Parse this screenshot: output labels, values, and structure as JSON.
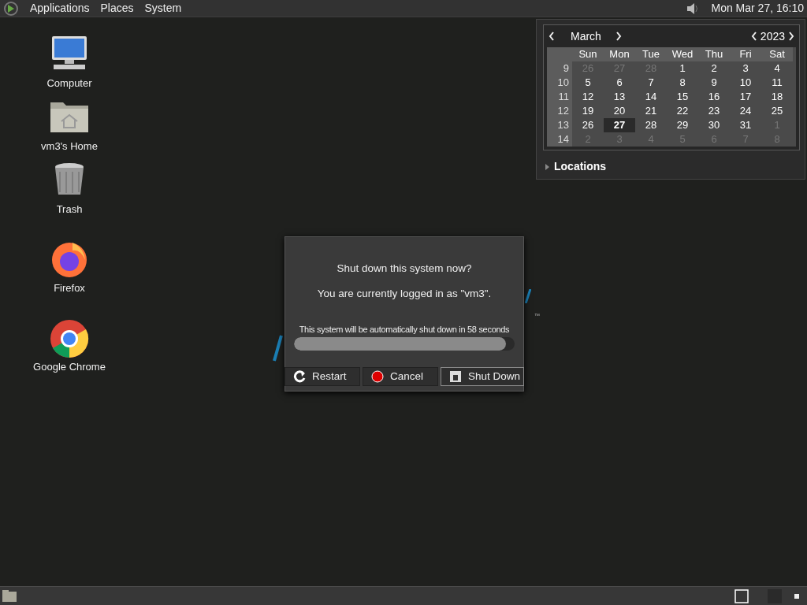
{
  "top_panel": {
    "menus": [
      "Applications",
      "Places",
      "System"
    ],
    "clock": "Mon Mar 27, 16:10"
  },
  "desktop_icons": [
    {
      "kind": "computer",
      "label": "Computer"
    },
    {
      "kind": "home",
      "label": "vm3's Home"
    },
    {
      "kind": "trash",
      "label": "Trash"
    },
    {
      "kind": "firefox",
      "label": "Firefox"
    },
    {
      "kind": "chrome",
      "label": "Google Chrome"
    }
  ],
  "calendar": {
    "month": "March",
    "year": "2023",
    "weekdays": [
      "Sun",
      "Mon",
      "Tue",
      "Wed",
      "Thu",
      "Fri",
      "Sat"
    ],
    "weeks": [
      {
        "number": "9",
        "days": [
          {
            "d": "26",
            "other": true,
            "selected": false
          },
          {
            "d": "27",
            "other": true,
            "selected": false
          },
          {
            "d": "28",
            "other": true,
            "selected": false
          },
          {
            "d": "1",
            "other": false,
            "selected": false
          },
          {
            "d": "2",
            "other": false,
            "selected": false
          },
          {
            "d": "3",
            "other": false,
            "selected": false
          },
          {
            "d": "4",
            "other": false,
            "selected": false
          }
        ]
      },
      {
        "number": "10",
        "days": [
          {
            "d": "5",
            "other": false,
            "selected": false
          },
          {
            "d": "6",
            "other": false,
            "selected": false
          },
          {
            "d": "7",
            "other": false,
            "selected": false
          },
          {
            "d": "8",
            "other": false,
            "selected": false
          },
          {
            "d": "9",
            "other": false,
            "selected": false
          },
          {
            "d": "10",
            "other": false,
            "selected": false
          },
          {
            "d": "11",
            "other": false,
            "selected": false
          }
        ]
      },
      {
        "number": "11",
        "days": [
          {
            "d": "12",
            "other": false,
            "selected": false
          },
          {
            "d": "13",
            "other": false,
            "selected": false
          },
          {
            "d": "14",
            "other": false,
            "selected": false
          },
          {
            "d": "15",
            "other": false,
            "selected": false
          },
          {
            "d": "16",
            "other": false,
            "selected": false
          },
          {
            "d": "17",
            "other": false,
            "selected": false
          },
          {
            "d": "18",
            "other": false,
            "selected": false
          }
        ]
      },
      {
        "number": "12",
        "days": [
          {
            "d": "19",
            "other": false,
            "selected": false
          },
          {
            "d": "20",
            "other": false,
            "selected": false
          },
          {
            "d": "21",
            "other": false,
            "selected": false
          },
          {
            "d": "22",
            "other": false,
            "selected": false
          },
          {
            "d": "23",
            "other": false,
            "selected": false
          },
          {
            "d": "24",
            "other": false,
            "selected": false
          },
          {
            "d": "25",
            "other": false,
            "selected": false
          }
        ]
      },
      {
        "number": "13",
        "days": [
          {
            "d": "26",
            "other": false,
            "selected": false
          },
          {
            "d": "27",
            "other": false,
            "selected": true
          },
          {
            "d": "28",
            "other": false,
            "selected": false
          },
          {
            "d": "29",
            "other": false,
            "selected": false
          },
          {
            "d": "30",
            "other": false,
            "selected": false
          },
          {
            "d": "31",
            "other": false,
            "selected": false
          },
          {
            "d": "1",
            "other": true,
            "selected": false
          }
        ]
      },
      {
        "number": "14",
        "days": [
          {
            "d": "2",
            "other": true,
            "selected": false
          },
          {
            "d": "3",
            "other": true,
            "selected": false
          },
          {
            "d": "4",
            "other": true,
            "selected": false
          },
          {
            "d": "5",
            "other": true,
            "selected": false
          },
          {
            "d": "6",
            "other": true,
            "selected": false
          },
          {
            "d": "7",
            "other": true,
            "selected": false
          },
          {
            "d": "8",
            "other": true,
            "selected": false
          }
        ]
      }
    ],
    "locations": {
      "label": "Locations",
      "expanded": false
    }
  },
  "wallpaper_logo": {
    "mark": "™"
  },
  "dialog": {
    "title": "Shut down this system now?",
    "message": "You are currently logged in as \"vm3\".",
    "countdown": "This system will be automatically shut down in 58 seconds",
    "progress": {
      "level": 0.96
    },
    "buttons": [
      {
        "kind": "restart",
        "label": "Restart",
        "focused": false
      },
      {
        "kind": "cancel",
        "label": "Cancel",
        "focused": false
      },
      {
        "kind": "shutdown",
        "label": "Shut Down",
        "focused": true
      }
    ]
  }
}
